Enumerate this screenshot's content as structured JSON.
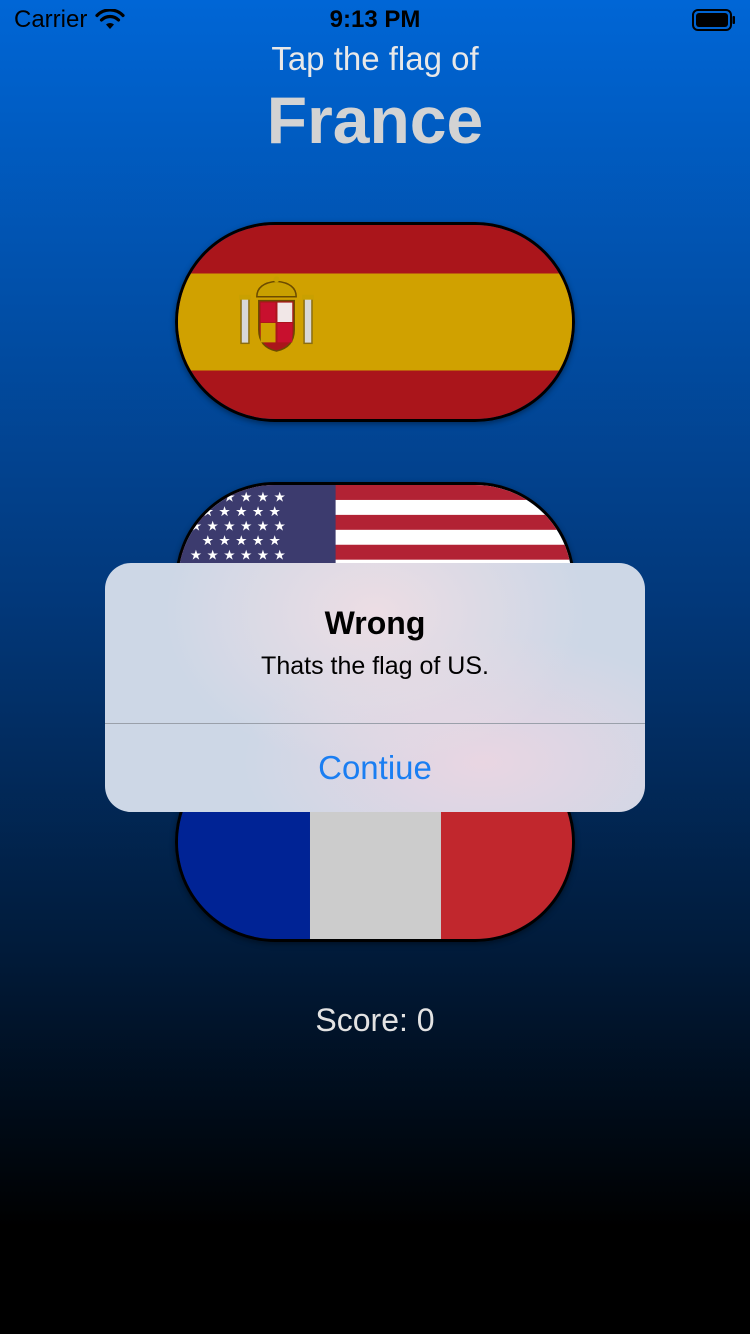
{
  "status_bar": {
    "carrier": "Carrier",
    "time": "9:13 PM",
    "wifi_icon": "wifi-icon",
    "battery_icon": "battery-icon"
  },
  "header": {
    "prompt": "Tap the flag of",
    "country": "France"
  },
  "flags": [
    {
      "country": "Spain",
      "icon": "spain-flag"
    },
    {
      "country": "US",
      "icon": "us-flag"
    },
    {
      "country": "France",
      "icon": "france-flag"
    }
  ],
  "score": {
    "text": "Score: 0"
  },
  "alert": {
    "title": "Wrong",
    "message": "Thats the flag of US.",
    "action": "Contiue"
  },
  "colors": {
    "background_top": "#0066d6",
    "background_bottom": "#000000",
    "alert_action": "#1a7ef2"
  }
}
